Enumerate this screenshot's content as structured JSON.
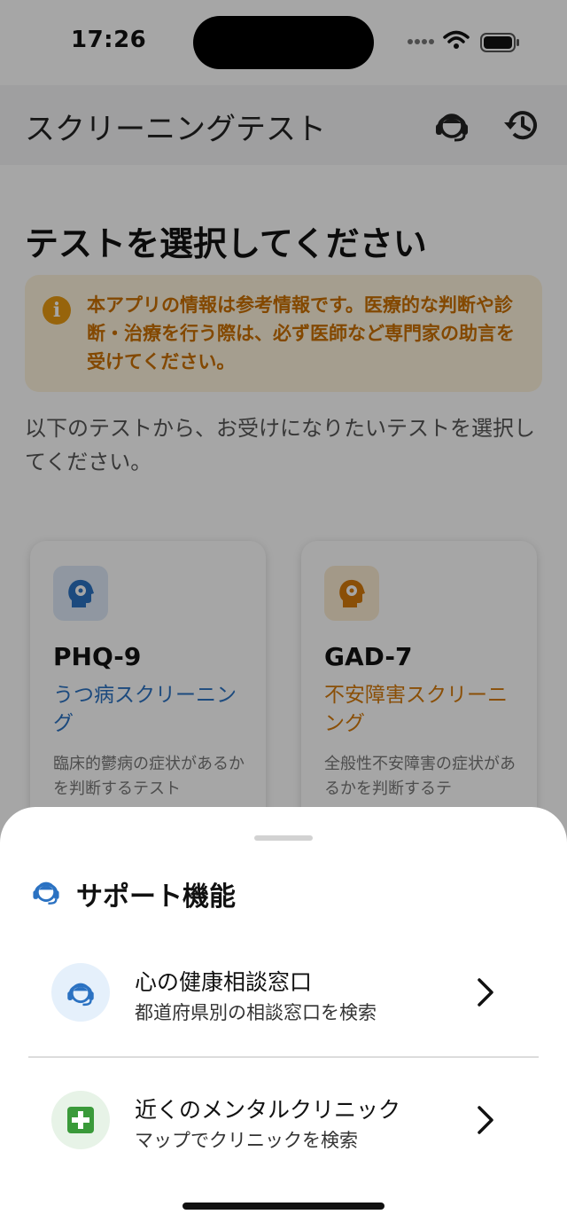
{
  "status_bar": {
    "time": "17:26"
  },
  "app_bar": {
    "title": "スクリーニングテスト"
  },
  "main": {
    "heading": "テストを選択してください",
    "notice": "本アプリの情報は参考情報です。医療的な判断や診断・治療を行う際は、必ず医師など専門家の助言を受けてください。",
    "intro": "以下のテストから、お受けになりたいテストを選択してください。",
    "cards": [
      {
        "name": "PHQ-9",
        "subtitle": "うつ病スクリーニング",
        "description": "臨床的鬱病の症状があるかを判断するテスト"
      },
      {
        "name": "GAD-7",
        "subtitle": "不安障害スクリーニング",
        "description": "全般性不安障害の症状があるかを判断するテ"
      }
    ]
  },
  "sheet": {
    "title": "サポート機能",
    "items": [
      {
        "label": "心の健康相談窓口",
        "sub": "都道府県別の相談窓口を検索"
      },
      {
        "label": "近くのメンタルクリニック",
        "sub": "マップでクリニックを検索"
      }
    ]
  },
  "colors": {
    "blue_accent": "#2b72c2",
    "orange_accent": "#d47a0c",
    "green_accent": "#3a9a3a"
  },
  "icons": {
    "top_left": "support-headset-icon",
    "top_right": "history-icon",
    "card": "brain-gear-icon",
    "row_1": "support-headset-icon",
    "row_2": "medical-cross-icon"
  }
}
